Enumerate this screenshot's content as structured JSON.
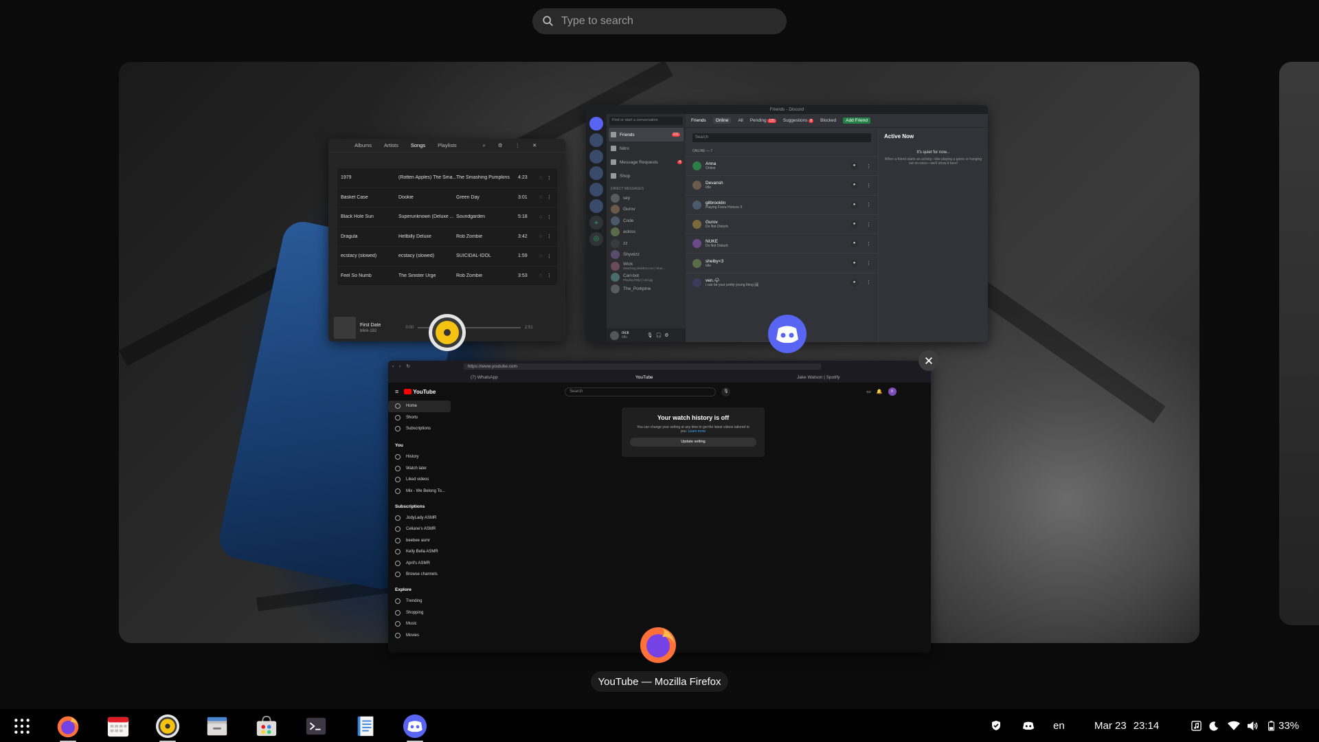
{
  "search": {
    "placeholder": "Type to search"
  },
  "window_label": "YouTube — Mozilla Firefox",
  "music": {
    "tabs": [
      "Albums",
      "Artists",
      "Songs",
      "Playlists"
    ],
    "songs": [
      {
        "title": "1979",
        "album": "(Rotten Apples) The Sma...",
        "artist": "The Smashing Pumpkins",
        "duration": "4:23"
      },
      {
        "title": "Basket Case",
        "album": "Dookie",
        "artist": "Green Day",
        "duration": "3:01"
      },
      {
        "title": "Black Hole Sun",
        "album": "Superunknown (Deluxe ...",
        "artist": "Soundgarden",
        "duration": "5:18"
      },
      {
        "title": "Dragula",
        "album": "Hellbilly Deluxe",
        "artist": "Rob Zombie",
        "duration": "3:42"
      },
      {
        "title": "ecstacy (slowed)",
        "album": "ecstacy (slowed)",
        "artist": "SUICIDAL-IDOL",
        "duration": "1:59"
      },
      {
        "title": "Feel So Numb",
        "album": "The Sinister Urge",
        "artist": "Rob Zombie",
        "duration": "3:53"
      }
    ],
    "now_playing": {
      "title": "First Date",
      "artist": "blink-182",
      "elapsed": "0:00",
      "total": "2:51"
    }
  },
  "discord": {
    "title": "Friends - Discord",
    "find_placeholder": "Find or start a conversation",
    "nav": [
      {
        "label": "Friends",
        "badge": "131"
      },
      {
        "label": "Nitro",
        "badge": ""
      },
      {
        "label": "Message Requests",
        "badge": "4"
      },
      {
        "label": "Shop",
        "badge": ""
      }
    ],
    "dm_header": "DIRECT MESSAGES",
    "dms": [
      "sey",
      "Gurov",
      "Code",
      "ackiss",
      "zz",
      "Shywizz",
      "Wick",
      "Carl-bot",
      "The_Porkpine"
    ],
    "dm_sub": {
      "Wick": "Watching wickbot.com | Shar...",
      "Carl-bot": "Playing /help | carl.gg"
    },
    "user": {
      "name": "nick",
      "status": "Idle"
    },
    "tabs": {
      "friends": "Friends",
      "online": "Online",
      "all": "All",
      "pending": "Pending",
      "pending_badge": "131",
      "suggestions": "Suggestions",
      "suggestions_badge": "8",
      "blocked": "Blocked",
      "add_friend": "Add Friend"
    },
    "search_placeholder": "Search",
    "online_header": "ONLINE — 7",
    "friends": [
      {
        "name": "Anna",
        "status": "Online"
      },
      {
        "name": "Devansh",
        "status": "Idle"
      },
      {
        "name": "gilbrooklin",
        "status": "Playing Forza Horizon 5"
      },
      {
        "name": "Gurov",
        "status": "Do Not Disturb"
      },
      {
        "name": "NUKE",
        "status": "Do Not Disturb"
      },
      {
        "name": "shelby<3",
        "status": "Idle"
      },
      {
        "name": "ven.🌩",
        "status": "i can be your pretty young thing 🖼"
      }
    ],
    "active_now": {
      "title": "Active Now",
      "quiet": "It's quiet for now...",
      "desc": "When a friend starts an activity—like playing a game or hanging out on voice—we'll show it here!"
    }
  },
  "firefox": {
    "url": "https://www.youtube.com",
    "tabs": [
      "(7) WhatsApp",
      "YouTube",
      "Jake Watson | Spotify"
    ],
    "yt": {
      "logo": "YouTube",
      "search_placeholder": "Search",
      "main": [
        "Home",
        "Shorts",
        "Subscriptions"
      ],
      "you_header": "You",
      "you": [
        "History",
        "Watch later",
        "Liked videos",
        "Mix - We Belong To..."
      ],
      "subs_header": "Subscriptions",
      "subs": [
        "JodyLady ASMR",
        "Celiane's ASMR",
        "beebee asmr",
        "Kelly Bella ASMR",
        "April's ASMR",
        "Browse channels"
      ],
      "explore_header": "Explore",
      "explore": [
        "Trending",
        "Shopping",
        "Music",
        "Movies"
      ],
      "card": {
        "title": "Your watch history is off",
        "body": "You can change your setting at any time to get the latest videos tailored to you.",
        "link": "Learn more",
        "button": "Update setting"
      },
      "avatar_letter": "n"
    }
  },
  "tray": {
    "lang": "en",
    "date": "Mar 23",
    "time": "23:14",
    "battery": "33%"
  },
  "colors": {
    "accent_discord": "#5865f2",
    "green": "#248046",
    "red": "#f23f43",
    "yt_red": "#ff0000"
  }
}
